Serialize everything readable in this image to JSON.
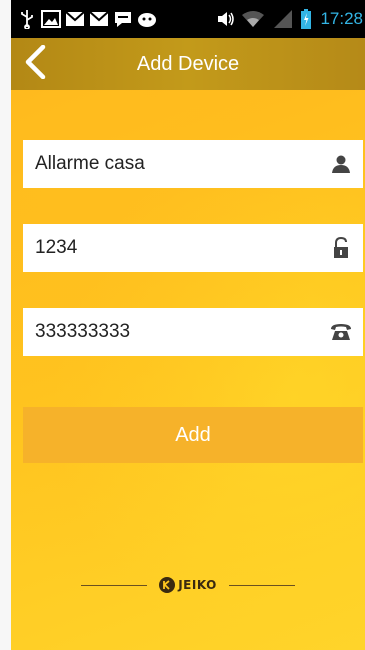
{
  "status_bar": {
    "time": "17:28",
    "left_icons": [
      "usb-icon",
      "image-icon",
      "mail-icon",
      "mail-icon",
      "chat-icon",
      "android-icon"
    ],
    "right_icons": [
      "volume-icon",
      "wifi-icon",
      "signal-icon",
      "battery-icon"
    ]
  },
  "header": {
    "title": "Add Device",
    "back_icon": "chevron-left-icon"
  },
  "form": {
    "name_value": "Allarme casa",
    "name_icon": "person-icon",
    "password_value": "1234",
    "password_icon": "lock-icon",
    "phone_value": "333333333",
    "phone_icon": "phone-icon",
    "add_label": "Add"
  },
  "brand": {
    "logo_text": "JEIKO"
  },
  "colors": {
    "titlebar": "#b8891a",
    "background_yellow": "#ffc51f",
    "button": "#f6b22a",
    "status_time": "#33b5e5"
  }
}
